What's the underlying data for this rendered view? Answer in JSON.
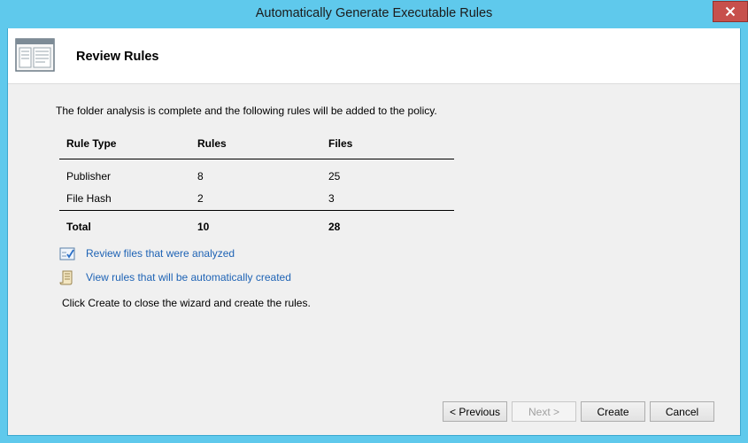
{
  "window": {
    "title": "Automatically Generate Executable Rules"
  },
  "header": {
    "title": "Review Rules"
  },
  "intro": "The folder analysis is complete and the following rules will be added to the policy.",
  "table": {
    "headers": [
      "Rule Type",
      "Rules",
      "Files"
    ],
    "rows": [
      [
        "Publisher",
        "8",
        "25"
      ],
      [
        "File Hash",
        "2",
        "3"
      ]
    ],
    "total": [
      "Total",
      "10",
      "28"
    ]
  },
  "links": [
    {
      "label": "Review files that were analyzed",
      "icon": "checklist-icon"
    },
    {
      "label": "View rules that will be automatically created",
      "icon": "scroll-document-icon"
    }
  ],
  "footer_text": "Click Create to close the wizard and create the rules.",
  "buttons": {
    "previous": "< Previous",
    "next": "Next >",
    "create": "Create",
    "cancel": "Cancel"
  }
}
